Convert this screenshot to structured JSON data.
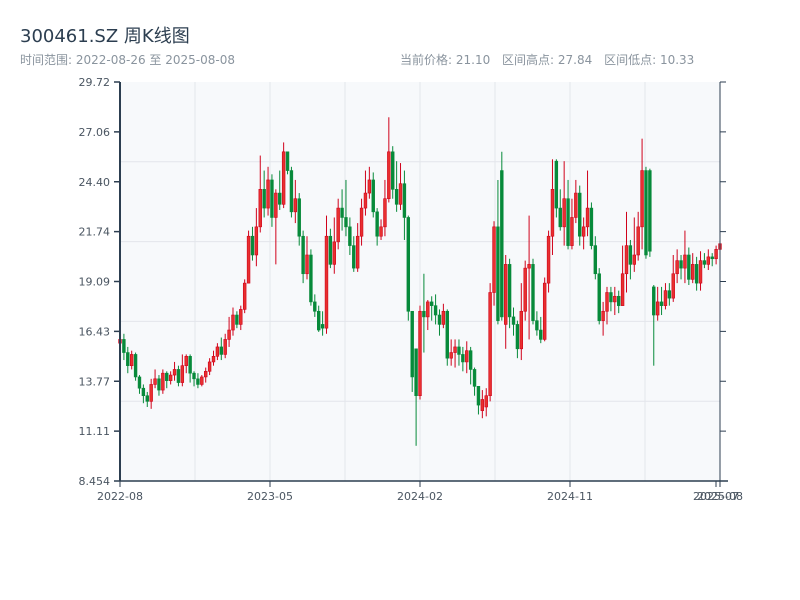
{
  "header": {
    "title": "300461.SZ 周K线图",
    "range_label": "时间范围: 2022-08-26 至 2025-08-08",
    "current_price": "当前价格: 21.10",
    "range_high": "区间高点: 27.84",
    "range_low": "区间低点: 10.33"
  },
  "chart_data": {
    "type": "candlestick",
    "title": "300461.SZ 周K线图",
    "date_range": [
      "2022-08-26",
      "2025-08-08"
    ],
    "ylim": [
      8.454,
      29.72
    ],
    "y_ticks": [
      "29.72",
      "27.06",
      "24.40",
      "21.74",
      "19.09",
      "16.43",
      "13.77",
      "11.11",
      "8.454"
    ],
    "x_ticks": [
      "2022-08",
      "2023-05",
      "2024-02",
      "2024-11",
      "2025-07",
      "2025-08"
    ],
    "grid": true,
    "colors": {
      "up": "#d0021b",
      "down": "#078a3a",
      "plot_bg": "#f7f9fb",
      "axis": "#2c3e50",
      "grid": "#e3e6eb"
    },
    "ohlc_fields": [
      "open",
      "close",
      "low",
      "high"
    ],
    "candles": [
      [
        15.8,
        16.0,
        15.5,
        16.4
      ],
      [
        16.0,
        15.3,
        14.9,
        16.3
      ],
      [
        15.3,
        14.6,
        14.2,
        15.6
      ],
      [
        14.6,
        15.2,
        14.4,
        15.4
      ],
      [
        15.2,
        14.0,
        13.8,
        15.3
      ],
      [
        14.0,
        13.4,
        13.1,
        14.1
      ],
      [
        13.4,
        13.0,
        12.6,
        13.6
      ],
      [
        13.0,
        12.7,
        12.4,
        13.2
      ],
      [
        12.7,
        13.6,
        12.3,
        13.9
      ],
      [
        13.6,
        13.9,
        13.4,
        14.4
      ],
      [
        13.9,
        13.3,
        13.0,
        14.1
      ],
      [
        13.3,
        14.2,
        13.1,
        14.4
      ],
      [
        14.2,
        13.8,
        13.4,
        14.3
      ],
      [
        13.8,
        14.1,
        13.6,
        14.3
      ],
      [
        14.1,
        14.4,
        13.8,
        14.8
      ],
      [
        14.4,
        13.7,
        13.5,
        14.6
      ],
      [
        13.7,
        14.6,
        13.5,
        15.2
      ],
      [
        14.6,
        15.1,
        14.2,
        15.2
      ],
      [
        15.1,
        14.2,
        13.7,
        15.2
      ],
      [
        14.2,
        13.9,
        13.5,
        14.3
      ],
      [
        13.9,
        13.6,
        13.4,
        14.2
      ],
      [
        13.6,
        14.0,
        13.5,
        14.1
      ],
      [
        14.0,
        14.3,
        13.7,
        14.5
      ],
      [
        14.3,
        14.8,
        14.1,
        15.0
      ],
      [
        14.8,
        15.1,
        14.6,
        15.4
      ],
      [
        15.1,
        15.6,
        14.9,
        15.8
      ],
      [
        15.6,
        15.2,
        14.9,
        16.1
      ],
      [
        15.2,
        16.0,
        15.0,
        16.3
      ],
      [
        16.0,
        16.5,
        15.6,
        17.2
      ],
      [
        16.5,
        17.3,
        16.2,
        17.7
      ],
      [
        17.3,
        16.8,
        16.6,
        17.5
      ],
      [
        16.8,
        17.6,
        16.5,
        17.8
      ],
      [
        17.6,
        19.0,
        17.4,
        19.2
      ],
      [
        19.0,
        21.5,
        19.0,
        21.8
      ],
      [
        21.5,
        20.5,
        20.2,
        22.0
      ],
      [
        20.5,
        22.0,
        19.9,
        23.0
      ],
      [
        22.0,
        24.0,
        21.7,
        25.8
      ],
      [
        24.0,
        23.0,
        22.5,
        25.0
      ],
      [
        23.0,
        24.5,
        22.6,
        25.2
      ],
      [
        24.5,
        22.5,
        22.0,
        24.8
      ],
      [
        22.5,
        23.8,
        20.0,
        24.0
      ],
      [
        23.8,
        23.2,
        22.9,
        25.0
      ],
      [
        23.2,
        26.0,
        23.0,
        26.5
      ],
      [
        26.0,
        25.0,
        24.8,
        25.7
      ],
      [
        25.0,
        22.8,
        22.5,
        25.2
      ],
      [
        22.8,
        23.5,
        22.2,
        24.5
      ],
      [
        23.5,
        21.5,
        21.0,
        23.8
      ],
      [
        21.5,
        19.5,
        19.0,
        21.8
      ],
      [
        19.5,
        20.5,
        19.2,
        21.5
      ],
      [
        20.5,
        18.0,
        17.8,
        20.8
      ],
      [
        18.0,
        17.5,
        17.2,
        18.4
      ],
      [
        17.5,
        16.5,
        16.4,
        17.8
      ],
      [
        16.8,
        16.6,
        16.2,
        17.5
      ],
      [
        16.6,
        21.5,
        16.3,
        22.6
      ],
      [
        21.5,
        20.0,
        19.8,
        21.9
      ],
      [
        20.0,
        21.2,
        19.5,
        22.5
      ],
      [
        21.2,
        23.0,
        20.8,
        23.5
      ],
      [
        23.0,
        22.5,
        21.8,
        24.0
      ],
      [
        22.5,
        22.0,
        21.5,
        24.5
      ],
      [
        22.0,
        21.0,
        20.5,
        22.5
      ],
      [
        21.0,
        19.8,
        19.6,
        21.5
      ],
      [
        19.8,
        21.5,
        19.6,
        22.2
      ],
      [
        21.5,
        23.0,
        21.0,
        23.5
      ],
      [
        23.0,
        23.8,
        22.6,
        25.0
      ],
      [
        23.8,
        24.5,
        23.5,
        25.2
      ],
      [
        24.5,
        22.8,
        22.5,
        24.9
      ],
      [
        22.8,
        21.5,
        21.0,
        23.0
      ],
      [
        21.5,
        22.0,
        21.3,
        22.4
      ],
      [
        22.0,
        23.5,
        21.5,
        24.5
      ],
      [
        23.5,
        26.0,
        23.3,
        27.84
      ],
      [
        26.0,
        24.0,
        23.5,
        26.3
      ],
      [
        24.0,
        23.2,
        22.8,
        25.5
      ],
      [
        23.2,
        24.3,
        22.9,
        25.4
      ],
      [
        24.3,
        22.5,
        21.3,
        25.0
      ],
      [
        22.5,
        17.5,
        17.0,
        22.6
      ],
      [
        17.5,
        14.0,
        13.2,
        17.5
      ],
      [
        15.5,
        13.0,
        10.33,
        15.5
      ],
      [
        13.0,
        17.5,
        12.8,
        17.8
      ],
      [
        17.5,
        17.2,
        15.3,
        19.5
      ],
      [
        17.2,
        18.0,
        16.5,
        18.1
      ],
      [
        18.0,
        17.8,
        17.0,
        18.3
      ],
      [
        17.8,
        17.3,
        16.8,
        18.4
      ],
      [
        17.3,
        16.8,
        16.2,
        17.6
      ],
      [
        16.8,
        17.5,
        16.6,
        17.9
      ],
      [
        17.5,
        15.0,
        14.6,
        17.6
      ],
      [
        15.0,
        15.3,
        14.6,
        16.0
      ],
      [
        15.3,
        15.6,
        14.5,
        16.0
      ],
      [
        15.6,
        15.2,
        14.6,
        16.0
      ],
      [
        15.2,
        14.8,
        14.3,
        15.6
      ],
      [
        14.8,
        15.4,
        14.2,
        15.9
      ],
      [
        15.4,
        14.4,
        13.6,
        15.6
      ],
      [
        14.4,
        13.5,
        13.0,
        14.5
      ],
      [
        13.5,
        12.5,
        12.0,
        13.5
      ],
      [
        12.2,
        12.8,
        11.8,
        13.3
      ],
      [
        12.4,
        13.0,
        11.9,
        13.4
      ],
      [
        13.0,
        18.5,
        12.7,
        19.0
      ],
      [
        18.5,
        22.0,
        17.8,
        22.3
      ],
      [
        22.0,
        17.0,
        16.8,
        24.5
      ],
      [
        25.0,
        17.2,
        17.0,
        26.0
      ],
      [
        16.8,
        20.0,
        15.5,
        20.5
      ],
      [
        20.0,
        17.2,
        16.6,
        20.3
      ],
      [
        17.2,
        16.8,
        16.2,
        17.7
      ],
      [
        16.8,
        15.5,
        15.0,
        17.0
      ],
      [
        15.5,
        17.5,
        14.9,
        19.0
      ],
      [
        17.5,
        19.8,
        17.0,
        20.2
      ],
      [
        19.8,
        20.0,
        16.0,
        22.6
      ],
      [
        20.0,
        17.0,
        16.8,
        20.3
      ],
      [
        17.0,
        16.5,
        16.2,
        17.5
      ],
      [
        16.5,
        16.0,
        15.8,
        17.2
      ],
      [
        16.0,
        19.0,
        15.9,
        19.3
      ],
      [
        19.0,
        21.5,
        18.5,
        21.8
      ],
      [
        21.5,
        24.0,
        20.5,
        25.6
      ],
      [
        25.5,
        23.0,
        22.5,
        25.6
      ],
      [
        23.0,
        22.0,
        21.8,
        24.0
      ],
      [
        22.0,
        23.5,
        21.0,
        25.5
      ],
      [
        23.5,
        21.0,
        20.8,
        24.5
      ],
      [
        21.0,
        22.5,
        20.8,
        23.5
      ],
      [
        22.5,
        23.8,
        22.2,
        24.5
      ],
      [
        23.8,
        21.5,
        21.0,
        24.2
      ],
      [
        21.5,
        22.0,
        20.8,
        22.5
      ],
      [
        22.0,
        23.0,
        21.5,
        25.0
      ],
      [
        23.0,
        21.0,
        20.8,
        23.3
      ],
      [
        21.0,
        19.5,
        19.2,
        21.5
      ],
      [
        19.5,
        17.0,
        16.8,
        19.8
      ],
      [
        17.0,
        17.5,
        16.2,
        18.0
      ],
      [
        17.5,
        18.5,
        16.8,
        18.8
      ],
      [
        18.5,
        18.0,
        17.5,
        18.8
      ],
      [
        18.0,
        18.3,
        17.3,
        18.8
      ],
      [
        18.3,
        17.8,
        17.4,
        18.6
      ],
      [
        17.8,
        19.5,
        17.8,
        21.0
      ],
      [
        19.5,
        21.0,
        18.5,
        22.8
      ],
      [
        21.0,
        20.0,
        19.2,
        21.3
      ],
      [
        20.0,
        20.5,
        19.6,
        22.5
      ],
      [
        20.5,
        22.0,
        20.2,
        22.8
      ],
      [
        22.0,
        25.0,
        20.8,
        26.7
      ],
      [
        25.0,
        20.5,
        20.3,
        25.2
      ],
      [
        25.0,
        20.7,
        20.4,
        25.1
      ],
      [
        18.8,
        17.3,
        14.6,
        18.9
      ],
      [
        17.3,
        18.0,
        17.0,
        18.8
      ],
      [
        18.0,
        17.8,
        17.3,
        18.8
      ],
      [
        17.8,
        18.6,
        17.6,
        19.0
      ],
      [
        18.6,
        18.2,
        17.8,
        19.0
      ],
      [
        18.2,
        19.5,
        18.0,
        20.5
      ],
      [
        19.5,
        20.2,
        19.0,
        20.8
      ],
      [
        20.2,
        19.8,
        19.2,
        20.5
      ],
      [
        19.8,
        20.5,
        19.0,
        21.8
      ],
      [
        20.5,
        19.2,
        18.9,
        20.9
      ],
      [
        19.2,
        20.0,
        19.0,
        20.6
      ],
      [
        20.0,
        19.0,
        18.6,
        20.4
      ],
      [
        19.0,
        20.2,
        18.6,
        20.7
      ],
      [
        20.2,
        20.0,
        19.8,
        20.6
      ],
      [
        20.0,
        20.4,
        19.7,
        20.8
      ],
      [
        20.4,
        20.3,
        19.9,
        20.6
      ],
      [
        20.3,
        20.8,
        20.0,
        21.0
      ],
      [
        20.8,
        21.1,
        20.3,
        21.5
      ]
    ]
  }
}
